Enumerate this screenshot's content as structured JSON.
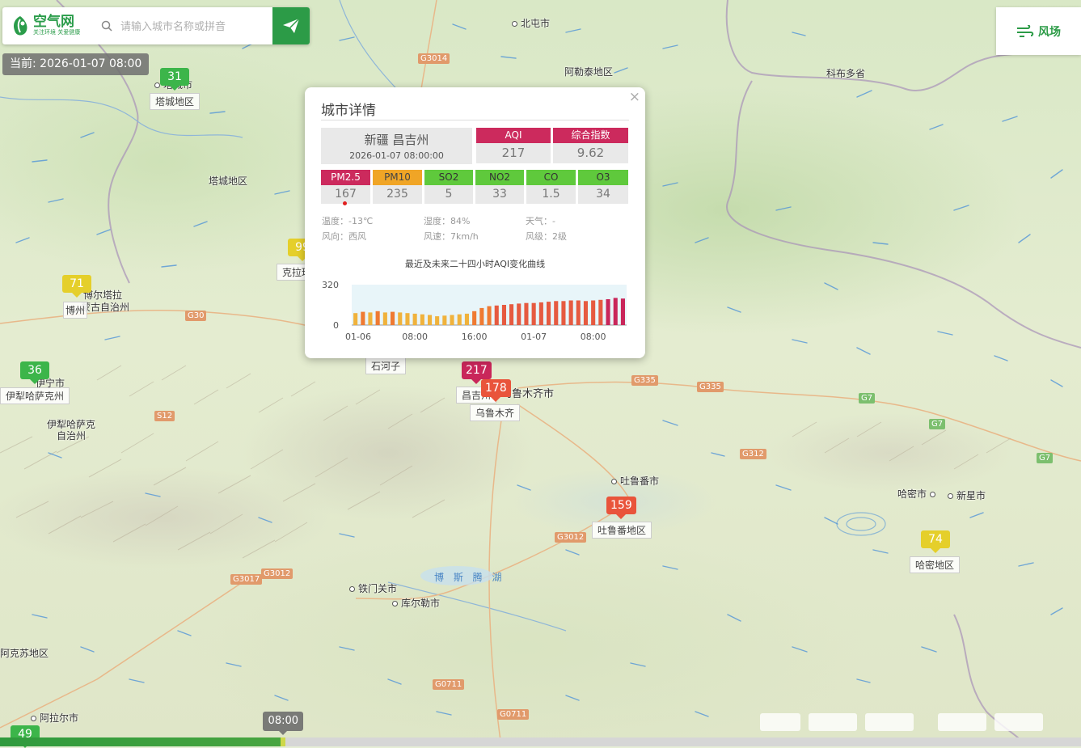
{
  "header": {
    "logo_name": "空气网",
    "logo_slogan": "关注环境 关爱健康",
    "search_placeholder": "请输入城市名称或拼音",
    "current_time": "当前: 2026-01-07 08:00"
  },
  "wind_toggle": {
    "label": "风场"
  },
  "map": {
    "places": [
      {
        "name": "北屯市"
      },
      {
        "name": "阿勒泰地区"
      },
      {
        "name": "科布多省"
      },
      {
        "name": "塔城市"
      },
      {
        "name": "塔城地区"
      },
      {
        "name": "塔城地区"
      },
      {
        "name": "克拉玛依"
      },
      {
        "name": "博尔塔拉"
      },
      {
        "name": "蒙古自治州"
      },
      {
        "name": "博州"
      },
      {
        "name": "伊宁市"
      },
      {
        "name": "伊犁哈萨克州"
      },
      {
        "name": "伊犁哈萨克"
      },
      {
        "name": "自治州"
      },
      {
        "name": "石河子"
      },
      {
        "name": "昌吉州"
      },
      {
        "name": "乌鲁木齐市"
      },
      {
        "name": "乌鲁木齐"
      },
      {
        "name": "吐鲁番市"
      },
      {
        "name": "吐鲁番地区"
      },
      {
        "name": "哈密市"
      },
      {
        "name": "新星市"
      },
      {
        "name": "哈密地区"
      },
      {
        "name": "铁门关市"
      },
      {
        "name": "库尔勒市"
      },
      {
        "name": "阿克苏地区"
      },
      {
        "name": "阿拉尔市"
      },
      {
        "name": "博 斯 腾 湖"
      }
    ],
    "roads": [
      "G3014",
      "G30",
      "S12",
      "G335",
      "G335",
      "G7",
      "G7",
      "G7",
      "G312",
      "G3012",
      "G3012",
      "G3017",
      "G0711",
      "G0711"
    ],
    "aqi_markers": [
      {
        "value": "31",
        "color": "#3cb54a"
      },
      {
        "value": "99",
        "color": "#e5cf2a"
      },
      {
        "value": "71",
        "color": "#e5cf2a"
      },
      {
        "value": "36",
        "color": "#3cb54a"
      },
      {
        "value": "217",
        "color": "#c9265a"
      },
      {
        "value": "178",
        "color": "#e9543b"
      },
      {
        "value": "159",
        "color": "#e9543b"
      },
      {
        "value": "74",
        "color": "#e5cf2a"
      },
      {
        "value": "49",
        "color": "#3cb54a"
      }
    ]
  },
  "popup": {
    "title": "城市详情",
    "close": "×",
    "city": "新疆 昌吉州",
    "time": "2026-01-07 08:00:00",
    "aqi": {
      "label": "AQI",
      "value": "217",
      "color": "#cc2a5d"
    },
    "composite": {
      "label": "综合指数",
      "value": "9.62",
      "color": "#cc2a5d"
    },
    "pollutants": [
      {
        "label": "PM2.5",
        "value": "167",
        "color": "#cc2a5d"
      },
      {
        "label": "PM10",
        "value": "235",
        "color": "#f0a526"
      },
      {
        "label": "SO2",
        "value": "5",
        "color": "#5fc93c"
      },
      {
        "label": "NO2",
        "value": "33",
        "color": "#5fc93c"
      },
      {
        "label": "CO",
        "value": "1.5",
        "color": "#5fc93c"
      },
      {
        "label": "O3",
        "value": "34",
        "color": "#5fc93c"
      }
    ],
    "weather": {
      "temperature": "温度：-13℃",
      "humidity": "湿度：84%",
      "weather": "天气：-",
      "wind_direction": "风向：西风",
      "wind_speed": "风速：7km/h",
      "wind_level": "风级：2级"
    },
    "chart_title": "最近及未来二十四小时AQI变化曲线"
  },
  "chart_data": {
    "type": "bar",
    "title": "最近及未来二十四小时AQI变化曲线",
    "ylim": [
      0,
      320
    ],
    "yticks": [
      "320",
      "0"
    ],
    "xticks": [
      "01-06",
      "08:00",
      "16:00",
      "01-07",
      "08:00"
    ],
    "xtick_index": [
      0,
      8,
      16,
      24,
      32
    ],
    "values": [
      95,
      105,
      100,
      110,
      100,
      105,
      100,
      95,
      90,
      85,
      80,
      70,
      75,
      80,
      85,
      90,
      110,
      135,
      150,
      155,
      160,
      165,
      170,
      175,
      175,
      180,
      185,
      190,
      190,
      195,
      195,
      190,
      195,
      200,
      205,
      215,
      210
    ],
    "colors": {
      "moderate": "#f0b23c",
      "unhealthy_sensitive": "#ef7a32",
      "unhealthy": "#e65a40",
      "very_unhealthy": "#c9265a"
    },
    "band_color": "#e8f5f9"
  },
  "timeline": {
    "current_label": "08:00",
    "progress": 0.262
  }
}
